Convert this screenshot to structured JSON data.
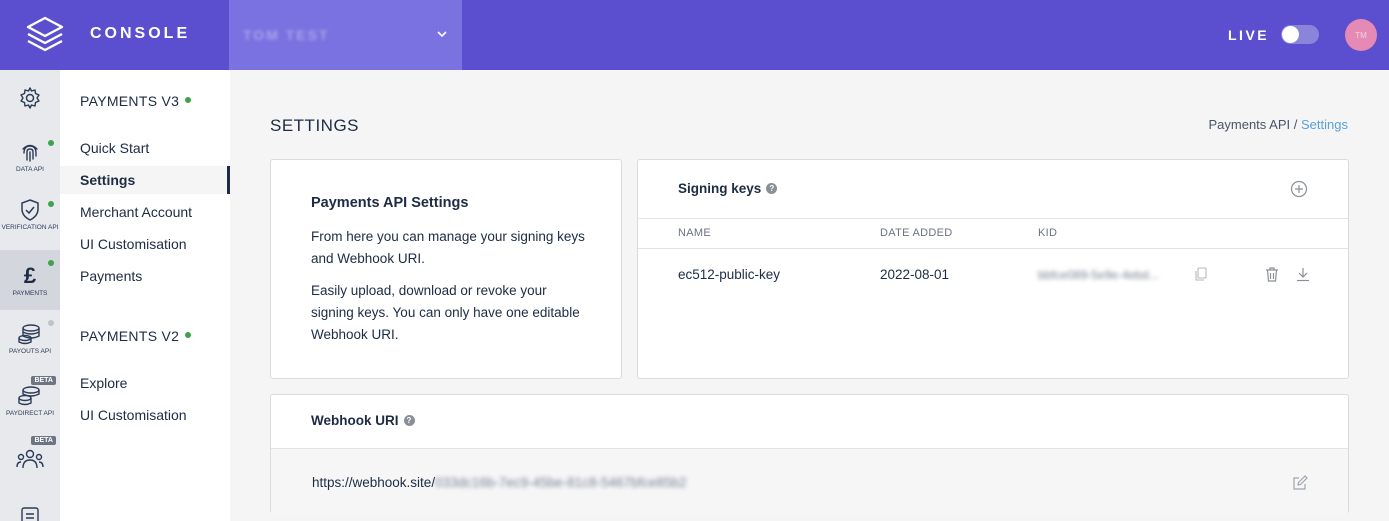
{
  "header": {
    "app_title": "CONSOLE",
    "account_name": "TOM TEST",
    "live_label": "LIVE",
    "live_toggle_on": false,
    "avatar_initials": "TM"
  },
  "rail": [
    {
      "id": "settings",
      "label": "",
      "icon": "gear-icon"
    },
    {
      "id": "data-api",
      "label": "DATA API",
      "icon": "fingerprint-icon",
      "status": "green"
    },
    {
      "id": "verification-api",
      "label": "VERIFICATION API",
      "icon": "shield-check-icon",
      "status": "green"
    },
    {
      "id": "payments",
      "label": "PAYMENTS",
      "icon": "pound-icon",
      "status": "green",
      "active": true
    },
    {
      "id": "payouts-api",
      "label": "PAYOUTS API",
      "icon": "coins-icon",
      "status": "grey"
    },
    {
      "id": "paydirect-api",
      "label": "PAYDIRECT API",
      "icon": "coins-stack-icon",
      "badge": "BETA"
    },
    {
      "id": "users",
      "label": "",
      "icon": "users-icon",
      "badge": "BETA"
    },
    {
      "id": "docs",
      "label": "",
      "icon": "document-icon"
    }
  ],
  "subnav": {
    "v3_heading": "PAYMENTS V3",
    "v3_items": [
      "Quick Start",
      "Settings",
      "Merchant Account",
      "UI Customisation",
      "Payments"
    ],
    "v3_active_index": 1,
    "v2_heading": "PAYMENTS V2",
    "v2_items": [
      "Explore",
      "UI Customisation"
    ]
  },
  "page": {
    "title": "SETTINGS",
    "breadcrumb_parent": "Payments API",
    "breadcrumb_separator": "/",
    "breadcrumb_current": "Settings"
  },
  "info_card": {
    "title": "Payments API Settings",
    "paragraph1": "From here you can manage your signing keys and Webhook URI.",
    "paragraph2": "Easily upload, download or revoke your signing keys. You can only have one editable Webhook URI."
  },
  "signing_keys": {
    "title": "Signing keys",
    "help": "?",
    "columns": [
      "NAME",
      "DATE ADDED",
      "KID"
    ],
    "rows": [
      {
        "name": "ec512-public-key",
        "date_added": "2022-08-01",
        "kid": "bbfce089-5e9e-4ebd..."
      }
    ]
  },
  "webhook": {
    "title": "Webhook URI",
    "help": "?",
    "url_prefix": "https://webhook.site/",
    "url_secret": "033dc16b-7ec9-45be-81c8-5467bfce85b2"
  },
  "colors": {
    "header_bg": "#5b4fcf",
    "account_bg": "#7a72e0",
    "status_green": "#3ea34c",
    "link_blue": "#5aa1d8",
    "text_dark": "#1d2b43"
  }
}
